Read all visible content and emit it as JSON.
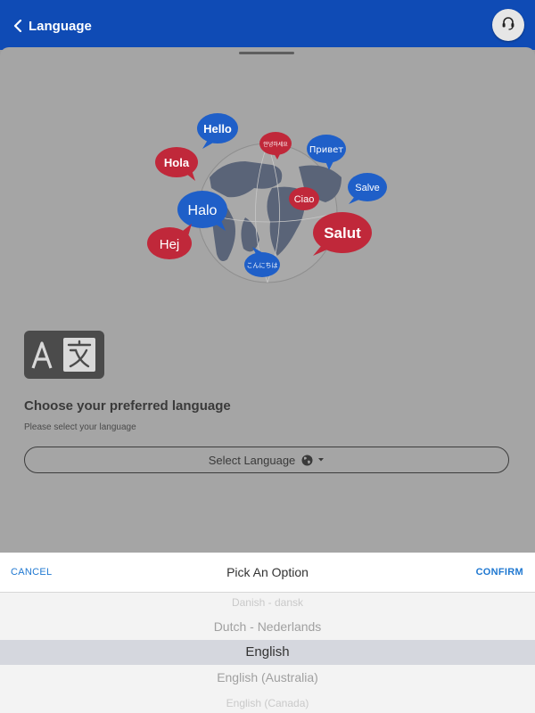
{
  "header": {
    "back_label": "Language"
  },
  "illustration": {
    "bubbles": {
      "hello": "Hello",
      "korean": "안녕하세요",
      "privet": "Привет",
      "hola": "Hola",
      "salve": "Salve",
      "ciao": "Ciao",
      "halo": "Halo",
      "salut": "Salut",
      "hej": "Hej",
      "konnichiwa": "こんにちは"
    }
  },
  "content": {
    "title": "Choose your preferred language",
    "subtitle": "Please select your language",
    "select_label": "Select Language"
  },
  "picker": {
    "cancel_label": "CANCEL",
    "title": "Pick An Option",
    "confirm_label": "CONFIRM",
    "options": [
      "Danish - dansk",
      "Dutch - Nederlands",
      "English",
      "English (Australia)",
      "English (Canada)"
    ],
    "selected": "English"
  },
  "colors": {
    "header": "#0f4bb5",
    "accent": "#1f78d1",
    "bubble_blue": "#1f5fc8",
    "bubble_red": "#c0283a"
  }
}
